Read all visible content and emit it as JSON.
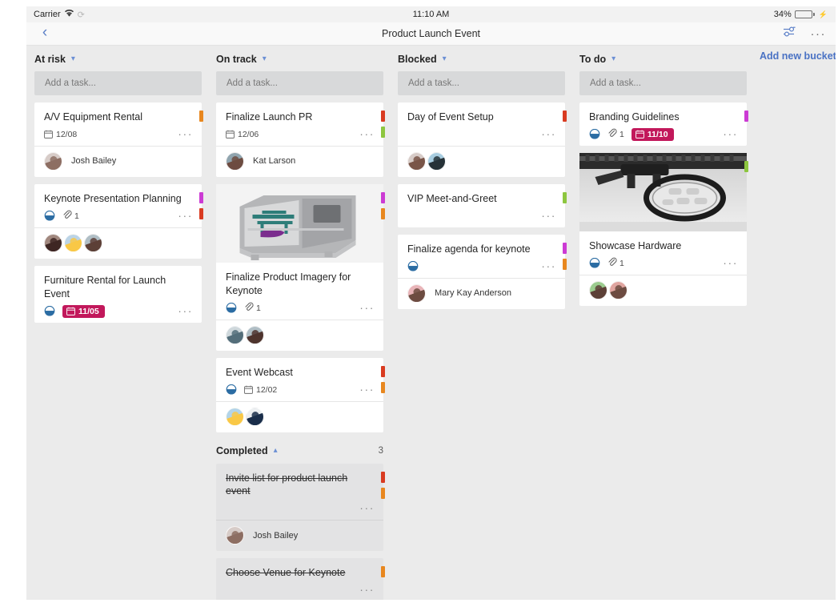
{
  "status_bar": {
    "carrier": "Carrier",
    "wifi_icon": "wifi-icon",
    "sync_icon": "sync-icon",
    "time": "11:10 AM",
    "battery_percent": "34%",
    "battery_level": 34,
    "charging_icon": "lightning-bolt-icon"
  },
  "nav": {
    "back_icon": "chevron-left-icon",
    "title": "Product Launch Event",
    "filter_icon": "filter-sliders-icon",
    "more_icon": "more-horizontal-icon"
  },
  "board": {
    "add_task_placeholder": "Add a task...",
    "add_bucket_label": "Add new bucket",
    "columns": [
      {
        "title": "At risk",
        "chevron_icon": "chevron-down-icon",
        "cards": [
          {
            "title": "A/V Equipment Rental",
            "date": "12/08",
            "date_late": false,
            "labels": [
              "#e8871f"
            ],
            "show_bucket_icon": false,
            "attachments": null,
            "members": [
              {
                "name": "Josh Bailey",
                "color1": "#8d6e63",
                "color2": "#d7ccc8"
              }
            ],
            "show_names": true,
            "image": null,
            "completed": false
          },
          {
            "title": "Keynote Presentation Planning",
            "date": null,
            "date_late": false,
            "labels": [
              "#cc3bd4",
              "#d93b21"
            ],
            "show_bucket_icon": true,
            "attachments": "1",
            "members": [
              {
                "name": "",
                "color1": "#3e2723",
                "color2": "#a1887f"
              },
              {
                "name": "",
                "color1": "#f9c846",
                "color2": "#bcd4e6"
              },
              {
                "name": "",
                "color1": "#5d4037",
                "color2": "#b0bec5"
              }
            ],
            "show_names": false,
            "image": null,
            "completed": false
          },
          {
            "title": "Furniture Rental for Launch Event",
            "date": "11/05",
            "date_late": true,
            "labels": [],
            "show_bucket_icon": true,
            "attachments": null,
            "members": [],
            "show_names": false,
            "image": null,
            "completed": false
          }
        ]
      },
      {
        "title": "On track",
        "chevron_icon": "chevron-down-icon",
        "cards": [
          {
            "title": "Finalize Launch PR",
            "date": "12/06",
            "date_late": false,
            "labels": [
              "#d93b21",
              "#8dc63f"
            ],
            "show_bucket_icon": false,
            "attachments": null,
            "members": [
              {
                "name": "Kat Larson",
                "color1": "#6d4c41",
                "color2": "#90a4ae"
              }
            ],
            "show_names": true,
            "image": null,
            "completed": false
          },
          {
            "title": "Finalize Product Imagery for Keynote",
            "date": null,
            "date_late": false,
            "labels": [
              "#cc3bd4",
              "#e8871f"
            ],
            "show_bucket_icon": true,
            "attachments": "1",
            "members": [
              {
                "name": "",
                "color1": "#546e7a",
                "color2": "#cfd8dc"
              },
              {
                "name": "",
                "color1": "#4e342e",
                "color2": "#b0bec5"
              }
            ],
            "show_names": false,
            "image": "machine-illustration",
            "completed": false
          },
          {
            "title": "Event Webcast",
            "date": "12/02",
            "date_late": false,
            "labels": [
              "#d93b21",
              "#e8871f"
            ],
            "show_bucket_icon": true,
            "attachments": null,
            "members": [
              {
                "name": "",
                "color1": "#f9c846",
                "color2": "#b3d4e8"
              },
              {
                "name": "",
                "color1": "#1a2e4a",
                "color2": "#eceff1"
              }
            ],
            "show_names": false,
            "image": null,
            "completed": false
          }
        ],
        "section": {
          "title": "Completed",
          "chevron_icon": "chevron-up-icon",
          "count": "3",
          "cards": [
            {
              "title": "Invite list for product launch event",
              "date": null,
              "date_late": false,
              "labels": [
                "#d93b21",
                "#e8871f"
              ],
              "show_bucket_icon": false,
              "attachments": null,
              "members": [
                {
                  "name": "Josh Bailey",
                  "color1": "#8d6e63",
                  "color2": "#d7ccc8"
                }
              ],
              "show_names": true,
              "image": null,
              "completed": true
            },
            {
              "title": "Choose Venue for Keynote",
              "date": null,
              "date_late": false,
              "labels": [
                "#e8871f"
              ],
              "show_bucket_icon": false,
              "attachments": null,
              "members": [],
              "show_names": false,
              "image": null,
              "completed": true
            }
          ]
        }
      },
      {
        "title": "Blocked",
        "chevron_icon": "chevron-down-icon",
        "cards": [
          {
            "title": "Day of Event Setup",
            "date": null,
            "date_late": false,
            "labels": [
              "#d93b21"
            ],
            "show_bucket_icon": false,
            "attachments": null,
            "members": [
              {
                "name": "",
                "color1": "#795548",
                "color2": "#d7ccc8"
              },
              {
                "name": "",
                "color1": "#263238",
                "color2": "#a8cde0"
              }
            ],
            "show_names": false,
            "image": null,
            "completed": false
          },
          {
            "title": "VIP Meet-and-Greet",
            "date": null,
            "date_late": false,
            "labels": [
              "#8dc63f"
            ],
            "show_bucket_icon": false,
            "attachments": null,
            "members": [],
            "show_names": false,
            "image": null,
            "completed": false
          },
          {
            "title": "Finalize agenda for keynote",
            "date": null,
            "date_late": false,
            "labels": [
              "#cc3bd4",
              "#e8871f"
            ],
            "show_bucket_icon": true,
            "attachments": null,
            "members": [
              {
                "name": "Mary Kay Anderson",
                "color1": "#6d4c41",
                "color2": "#e8b4b8"
              }
            ],
            "show_names": true,
            "image": null,
            "completed": false
          }
        ]
      },
      {
        "title": "To do",
        "chevron_icon": "chevron-down-icon",
        "cards": [
          {
            "title": "Branding Guidelines",
            "date": "11/10",
            "date_late": true,
            "labels": [
              "#cc3bd4"
            ],
            "show_bucket_icon": true,
            "attachments": "1",
            "members": [],
            "show_names": false,
            "image": null,
            "completed": false
          },
          {
            "title": "Showcase Hardware",
            "date": null,
            "date_late": false,
            "labels": [
              "#8dc63f"
            ],
            "show_bucket_icon": true,
            "attachments": "1",
            "members": [
              {
                "name": "",
                "color1": "#5d4037",
                "color2": "#9ccc8f"
              },
              {
                "name": "",
                "color1": "#6d4c41",
                "color2": "#e0a5a0"
              }
            ],
            "show_names": false,
            "image": "hardware-photo",
            "completed": false
          }
        ]
      }
    ]
  }
}
